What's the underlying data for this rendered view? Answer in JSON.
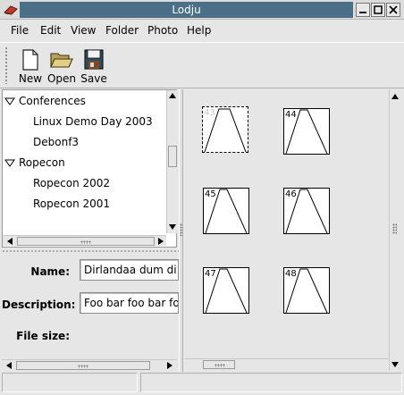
{
  "window": {
    "title": "Lodju",
    "controls": [
      "minimize-icon",
      "maximize-icon",
      "close-icon"
    ]
  },
  "menubar": {
    "items": [
      {
        "label": "File"
      },
      {
        "label": "Edit"
      },
      {
        "label": "View"
      },
      {
        "label": "Folder"
      },
      {
        "label": "Photo"
      },
      {
        "label": "Help"
      }
    ]
  },
  "toolbar": {
    "new_label": "New",
    "open_label": "Open",
    "save_label": "Save"
  },
  "tree": {
    "groups": [
      {
        "label": "Conferences",
        "children": [
          "Linux Demo Day 2003",
          "Debonf3"
        ]
      },
      {
        "label": "Ropecon",
        "children": [
          "Ropecon 2002",
          "Ropecon 2001"
        ]
      }
    ]
  },
  "properties": {
    "name_label": "Name:",
    "name_value": "Dirlandaa dum di dum",
    "description_label": "Description:",
    "description_value": "Foo bar foo bar foo ba",
    "filesize_label": "File size:"
  },
  "photos": [
    {
      "num": "43"
    },
    {
      "num": "44"
    },
    {
      "num": "45"
    },
    {
      "num": "46"
    },
    {
      "num": "47"
    },
    {
      "num": "48"
    }
  ]
}
